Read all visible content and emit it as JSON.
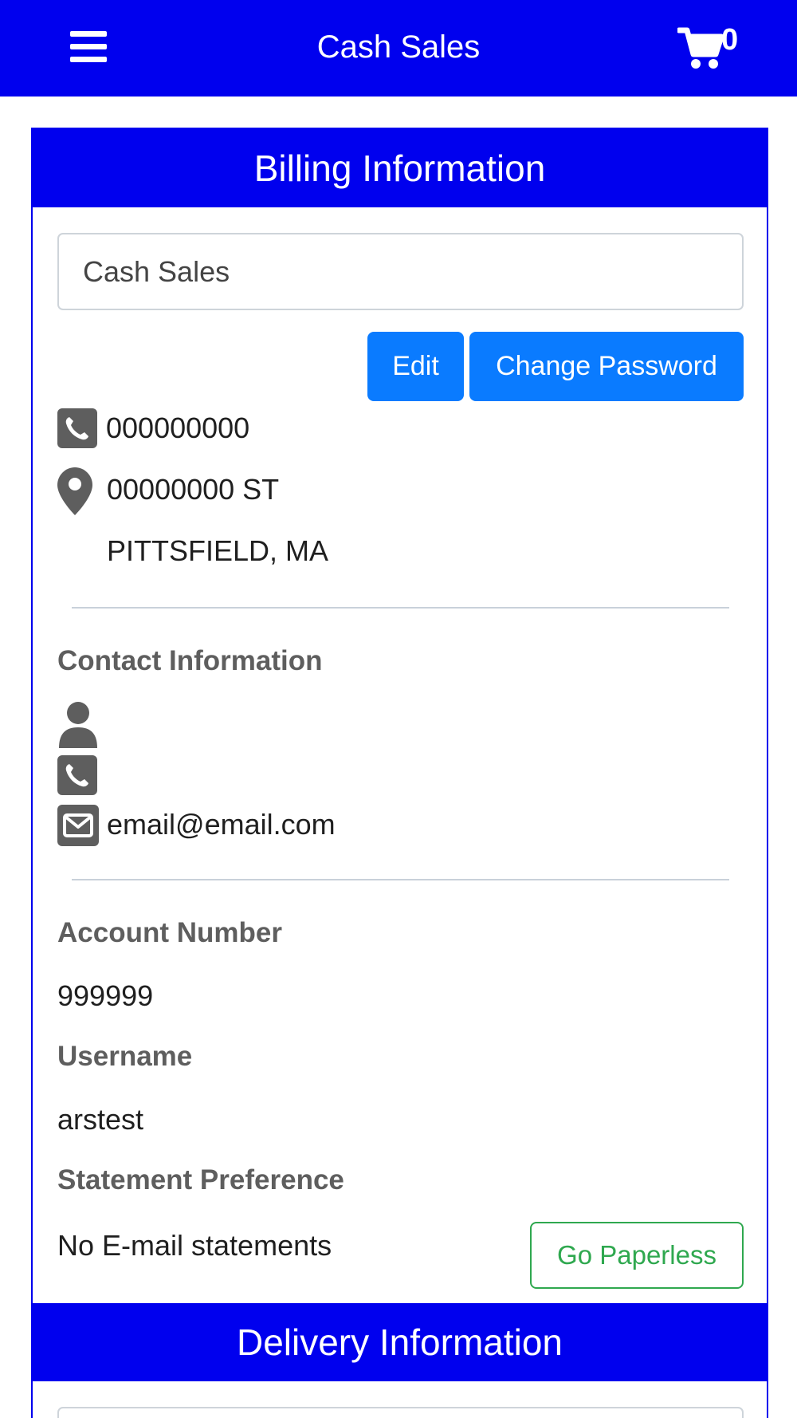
{
  "header": {
    "title": "Cash Sales",
    "cart_count": "0"
  },
  "billing": {
    "heading": "Billing Information",
    "account_name": "Cash Sales",
    "edit_label": "Edit",
    "change_password_label": "Change Password",
    "phone": "000000000",
    "address_line1": "00000000 ST",
    "address_line2": "PITTSFIELD, MA",
    "contact": {
      "heading": "Contact Information",
      "name": "",
      "phone": "",
      "email": "email@email.com"
    },
    "account_number_label": "Account Number",
    "account_number": "999999",
    "username_label": "Username",
    "username": "arstest",
    "statement_label": "Statement Preference",
    "statement_value": "No E-mail statements",
    "paperless_label": "Go Paperless"
  },
  "delivery": {
    "heading": "Delivery Information"
  },
  "colors": {
    "brand_blue": "#0000ee",
    "button_blue": "#0a7bff",
    "success_green": "#2fa84f",
    "icon_gray": "#5e5e5e"
  },
  "icons": [
    "menu-icon",
    "cart-icon",
    "phone-icon",
    "map-marker-icon",
    "user-icon",
    "envelope-icon"
  ]
}
